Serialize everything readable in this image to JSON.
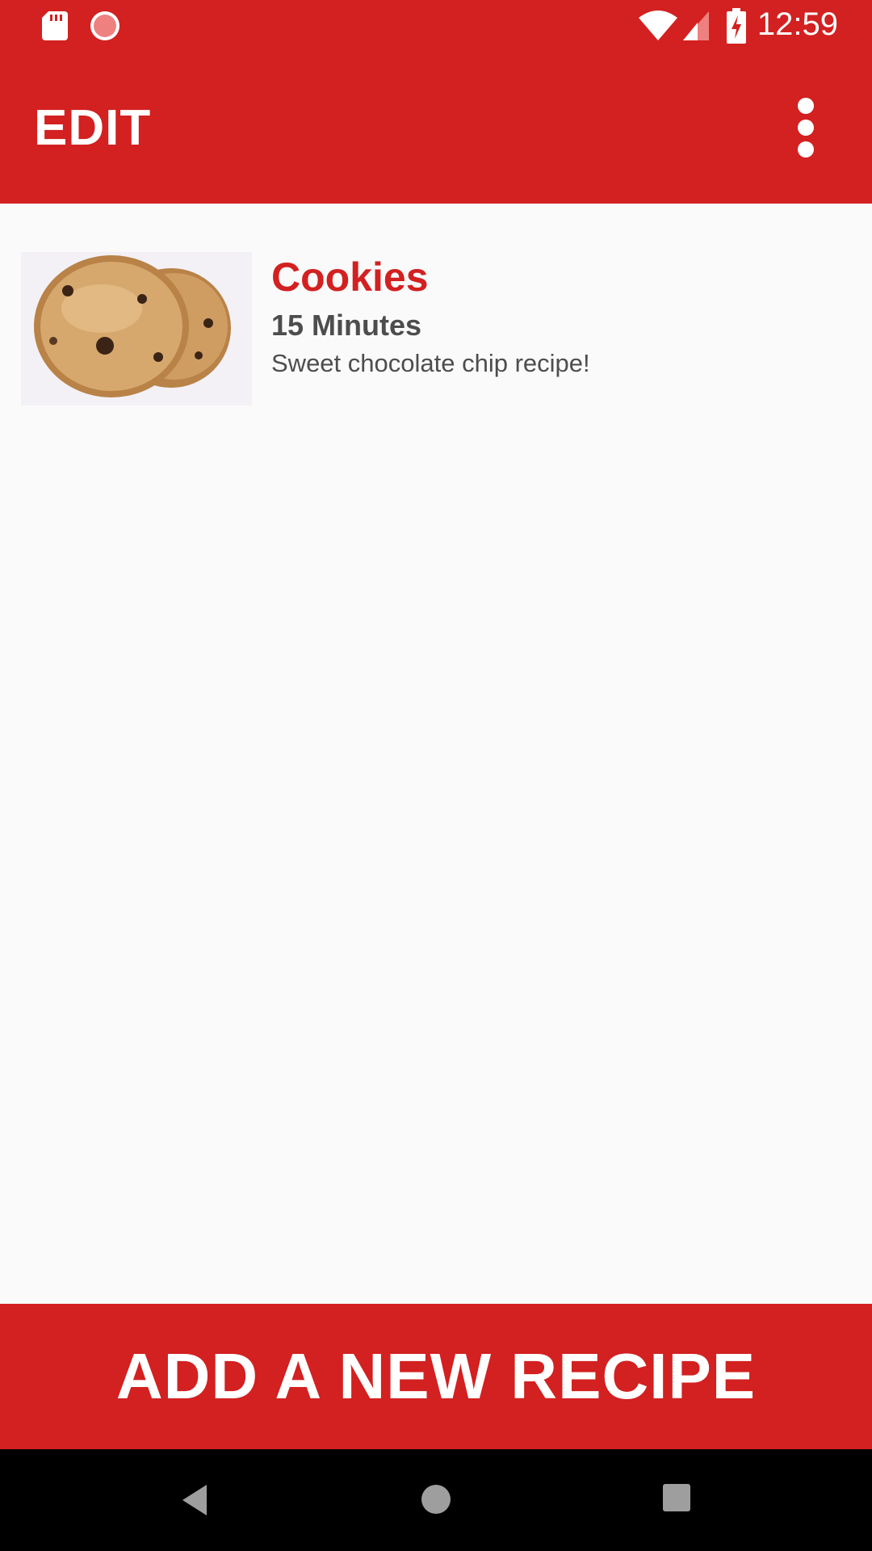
{
  "status_bar": {
    "time": "12:59",
    "icons": [
      "sd-card-icon",
      "loading-icon",
      "wifi-icon",
      "signal-icon",
      "battery-charging-icon"
    ]
  },
  "app_bar": {
    "title": "EDIT",
    "menu_icon": "overflow-menu-icon"
  },
  "recipes": [
    {
      "name": "Cookies",
      "time": "15 Minutes",
      "description": "Sweet chocolate chip recipe!",
      "image_icon": "cookie-image"
    }
  ],
  "add_button": {
    "label": "ADD A NEW RECIPE"
  },
  "nav_bar": {
    "icons": [
      "back-icon",
      "home-icon",
      "recents-icon"
    ]
  },
  "colors": {
    "primary": "#d32020",
    "text_secondary": "#4d4d4d",
    "background": "#fafafa"
  }
}
